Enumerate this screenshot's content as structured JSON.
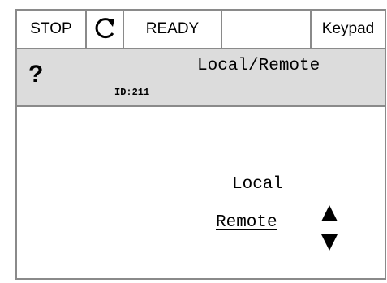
{
  "status_bar": {
    "state": "STOP",
    "rotation_icon": "rotate-icon",
    "readiness": "READY",
    "empty": "",
    "control_place": "Keypad"
  },
  "header": {
    "help_glyph": "?",
    "title": "Local/Remote",
    "id": "ID:211"
  },
  "options": [
    {
      "label": "Local",
      "selected": false
    },
    {
      "label": "Remote",
      "selected": true
    }
  ],
  "selector_icon": "up-down-arrows-icon"
}
